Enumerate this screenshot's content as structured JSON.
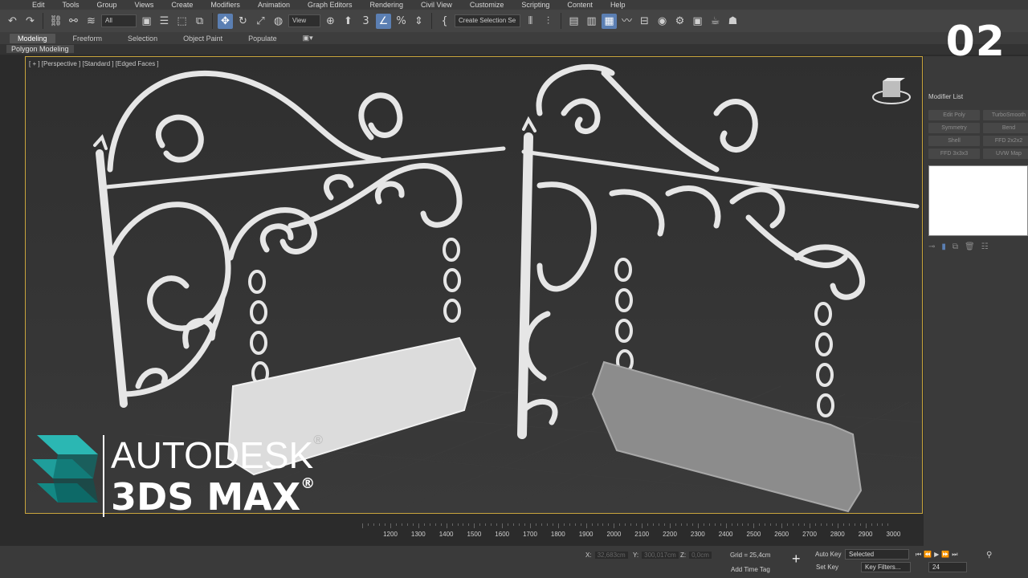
{
  "menu": [
    "Edit",
    "Tools",
    "Group",
    "Views",
    "Create",
    "Modifiers",
    "Animation",
    "Graph Editors",
    "Rendering",
    "Civil View",
    "Customize",
    "Scripting",
    "Content",
    "Help"
  ],
  "toolbar": {
    "filter_select": "All",
    "view_select": "View",
    "selection_set": "Create Selection Se"
  },
  "ribbon": {
    "tabs": [
      "Modeling",
      "Freeform",
      "Selection",
      "Object Paint",
      "Populate"
    ],
    "active_tab": "Modeling",
    "panel_label": "Polygon Modeling"
  },
  "viewport": {
    "label": "[ + ] [Perspective ] [Standard ] [Edged Faces ]"
  },
  "command_panel": {
    "modifier_list": "Modifier List",
    "modifiers": [
      "Edit Poly",
      "TurboSmooth",
      "Symmetry",
      "Bend",
      "Shell",
      "FFD 2x2x2",
      "FFD 3x3x3",
      "UVW Map"
    ]
  },
  "timeline": {
    "ticks": [
      "1200",
      "1300",
      "1400",
      "1500",
      "1600",
      "1700",
      "1800",
      "1900",
      "2000",
      "2100",
      "2200",
      "2300",
      "2400",
      "2500",
      "2600",
      "2700",
      "2800",
      "2900",
      "3000"
    ]
  },
  "status": {
    "x_label": "X:",
    "x_value": "32,683cm",
    "y_label": "Y:",
    "y_value": "300,017cm",
    "z_label": "Z:",
    "z_value": "0,0cm",
    "grid": "Grid = 25,4cm",
    "add_time_tag": "Add Time Tag",
    "auto_key": "Auto Key",
    "set_key": "Set Key",
    "selected": "Selected",
    "key_filters": "Key Filters...",
    "frame": "24"
  },
  "overlay": {
    "episode": "02",
    "brand_line1": "AUTODESK",
    "brand_line1_mark": "®",
    "brand_line2": "3DS MAX",
    "brand_line2_mark": "®"
  },
  "colors": {
    "accent": "#5b7fb3",
    "viewport_border": "#c8a43c",
    "logo_teal": "#1aa6a6"
  }
}
